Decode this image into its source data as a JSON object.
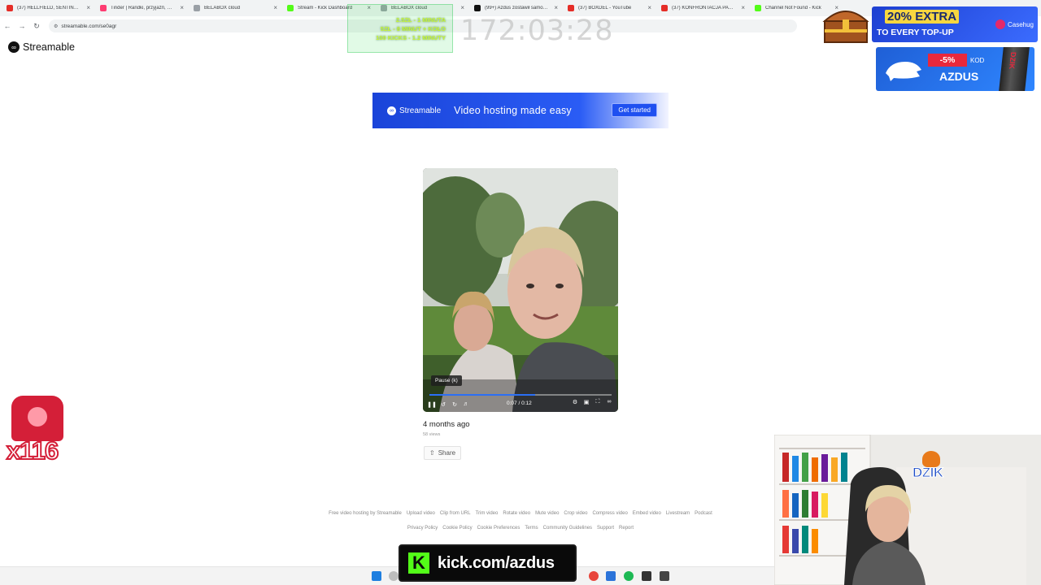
{
  "browser": {
    "tabs": [
      {
        "title": "(37) HELLFIELD, SENTINO - M",
        "color": "#e52d27"
      },
      {
        "title": "Tinder | Randki, przyjaźń, now",
        "color": "#fe3c72"
      },
      {
        "title": "BELABOX cloud",
        "color": "#9aa0a6"
      },
      {
        "title": "Stream - Kick Dashboard",
        "color": "#53fc18"
      },
      {
        "title": "BELABOX cloud",
        "color": "#9aa0a6"
      },
      {
        "title": "(99+) Azdus zostawił samocho",
        "color": "#111111"
      },
      {
        "title": "(37) BOXDEL - YouTube",
        "color": "#e52d27"
      },
      {
        "title": "(37) KONFRONTACJA PAJACÓ",
        "color": "#e52d27"
      },
      {
        "title": "Channel Not Found - Kick",
        "color": "#53fc18"
      }
    ],
    "url": "streamable.com/se0agr"
  },
  "page": {
    "logo": "Streamable",
    "banner": {
      "brand": "Streamable",
      "tagline": "Video hosting made easy",
      "cta": "Get started"
    },
    "player": {
      "tooltip": "Pause (k)",
      "time": "0:07 / 0:12",
      "progress": 0.58
    },
    "meta": {
      "age": "4 months ago",
      "views": "58 views",
      "share": "Share"
    },
    "footer": {
      "row1": [
        "Free video hosting by Streamable",
        "Upload video",
        "Clip from URL",
        "Trim video",
        "Rotate video",
        "Mute video",
        "Crop video",
        "Compress video",
        "Embed video",
        "Livestream",
        "Podcast"
      ],
      "row2": [
        "Privacy Policy",
        "Cookie Policy",
        "Cookie Preferences",
        "Terms",
        "Community Guidelines",
        "Support",
        "Report"
      ]
    }
  },
  "overlay": {
    "goals": [
      "2.5ZŁ - 1 MINUTA",
      "5ZŁ - 8 MINUT + KOŁO",
      "100 KICKS - 1.2 MINUTY"
    ],
    "timer": "172:03:28",
    "case_ad": {
      "percent": "20% EXTRA",
      "line2": "TO EVERY TOP-UP",
      "brand": "Casehug"
    },
    "dzik_ad": {
      "percent": "-5%",
      "kod": "KOD",
      "code": "AZDUS",
      "can": "DZIK"
    },
    "counter": "x116",
    "webcam_logo": "DZIK",
    "kick": {
      "letter": "K",
      "url": "kick.com/azdus"
    },
    "accent": "#53fc18"
  }
}
